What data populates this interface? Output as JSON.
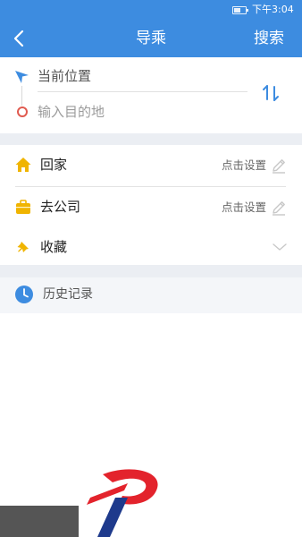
{
  "status_bar": {
    "time": "下午3:04"
  },
  "nav": {
    "title": "导乘",
    "search_label": "搜索"
  },
  "route": {
    "origin_value": "当前位置",
    "destination_placeholder": "输入目的地"
  },
  "favorites": {
    "items": [
      {
        "label": "回家",
        "hint": "点击设置"
      },
      {
        "label": "去公司",
        "hint": "点击设置"
      },
      {
        "label": "收藏"
      }
    ]
  },
  "history": {
    "label": "历史记录"
  },
  "icons": {
    "back": "back-arrow-icon",
    "start": "navigation-pointer-icon",
    "destination": "destination-circle-icon",
    "swap": "swap-arrows-icon",
    "home": "home-icon",
    "company": "briefcase-icon",
    "favorites": "pin-icon",
    "edit": "pencil-icon",
    "expand": "chevron-down-icon",
    "history": "clock-icon"
  },
  "colors": {
    "primary_blue": "#3d8ce0",
    "home_yellow": "#f0b400",
    "destination_red": "#e05a4f",
    "logo_red": "#e3232c",
    "logo_navy": "#1e3a8c"
  }
}
